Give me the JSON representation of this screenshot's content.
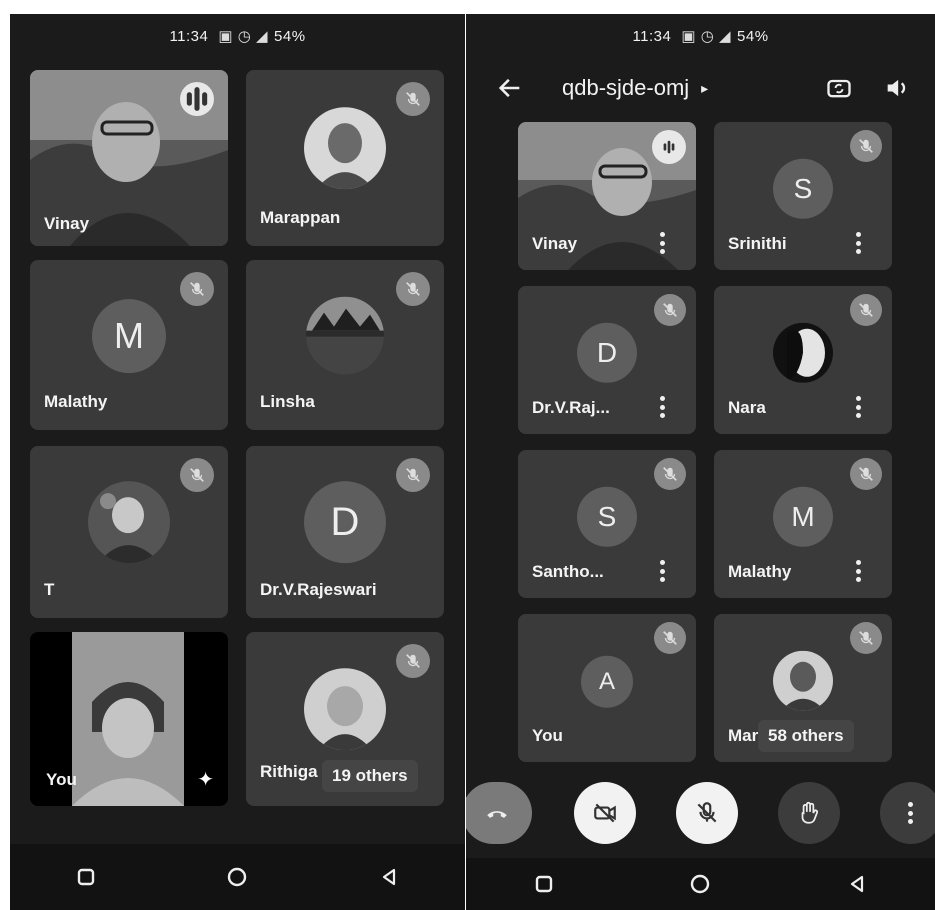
{
  "left": {
    "status_time": "11:34",
    "status_battery": "54%",
    "tiles": [
      {
        "name": "Vinay"
      },
      {
        "name": "Marappan"
      },
      {
        "name": "Malathy",
        "initial": "M"
      },
      {
        "name": "Linsha"
      },
      {
        "name": "T"
      },
      {
        "name": "Dr.V.Rajeswari",
        "initial": "D"
      },
      {
        "name": "You"
      },
      {
        "name": "Rithiga"
      }
    ],
    "others_label": "19 others"
  },
  "right": {
    "status_time": "11:34",
    "status_battery": "54%",
    "meeting_code": "qdb-sjde-omj",
    "tiles": [
      {
        "name": "Vinay"
      },
      {
        "name": "Srinithi",
        "initial": "S"
      },
      {
        "name": "Dr.V.Raj...",
        "initial": "D"
      },
      {
        "name": "Nara"
      },
      {
        "name": "Santho...",
        "initial": "S"
      },
      {
        "name": "Malathy",
        "initial": "M"
      },
      {
        "name": "You",
        "initial": "A"
      },
      {
        "name": "Mar"
      }
    ],
    "others_label": "58 others"
  },
  "icons": {
    "back": "arrow-left-icon",
    "switch_camera": "switch-camera-icon",
    "speaker": "speaker-icon",
    "mic_off": "mic-off-icon",
    "speaking": "audio-level-icon",
    "end_call": "end-call-icon",
    "camera_off": "camera-off-icon",
    "hand": "raise-hand-icon",
    "more": "more-vert-icon",
    "effects": "sparkle-icon"
  },
  "colors": {
    "background": "#1b1b1b",
    "tile": "#3a3a3a",
    "end_call": "#7a7a7a"
  }
}
